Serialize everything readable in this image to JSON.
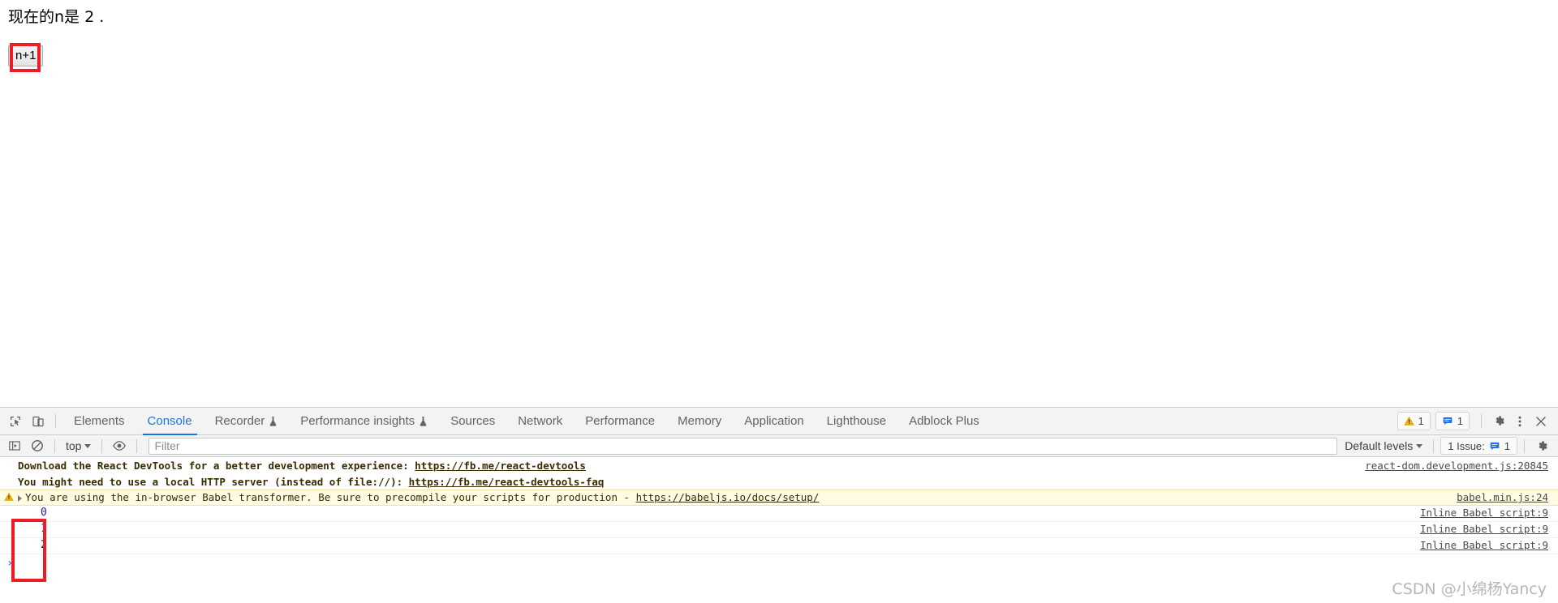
{
  "page": {
    "heading": "现在的n是 2 .",
    "button_label": "n+1"
  },
  "devtools": {
    "tabs": [
      {
        "label": "Elements",
        "active": false,
        "flask": false
      },
      {
        "label": "Console",
        "active": true,
        "flask": false
      },
      {
        "label": "Recorder",
        "active": false,
        "flask": true
      },
      {
        "label": "Performance insights",
        "active": false,
        "flask": true
      },
      {
        "label": "Sources",
        "active": false,
        "flask": false
      },
      {
        "label": "Network",
        "active": false,
        "flask": false
      },
      {
        "label": "Performance",
        "active": false,
        "flask": false
      },
      {
        "label": "Memory",
        "active": false,
        "flask": false
      },
      {
        "label": "Application",
        "active": false,
        "flask": false
      },
      {
        "label": "Lighthouse",
        "active": false,
        "flask": false
      },
      {
        "label": "Adblock Plus",
        "active": false,
        "flask": false
      }
    ],
    "icons": {
      "inspect": "inspect-element-icon",
      "device": "device-toolbar-icon",
      "settings": "gear-icon",
      "more": "kebab-menu-icon",
      "close": "close-icon"
    },
    "warning_badge_count": "1",
    "message_badge_count": "1",
    "accent_color": "#1a73e8",
    "warning_color": "#f0b400",
    "message_color": "#1a73e8"
  },
  "console_toolbar": {
    "sidebar_toggle": "console-sidebar-icon",
    "clear_console": "clear-console-icon",
    "context": "top",
    "eye_icon": "live-expression-eye-icon",
    "filter_placeholder": "Filter",
    "filter_value": "",
    "levels": "Default levels",
    "issues_label": "1 Issue:",
    "issues_count": "1",
    "settings_icon": "gear-icon"
  },
  "console_messages": [
    {
      "type": "info",
      "text": "Download the React DevTools for a better development experience: ",
      "link": "https://fb.me/react-devtools",
      "source": "react-dom.development.js:20845",
      "show_source": true,
      "group": "start"
    },
    {
      "type": "info",
      "text": "You might need to use a local HTTP server (instead of file://): ",
      "link": "https://fb.me/react-devtools-faq",
      "source": "",
      "show_source": false,
      "group": "end"
    },
    {
      "type": "warning",
      "text": "You are using the in-browser Babel transformer. Be sure to precompile your scripts for production - ",
      "link": "https://babeljs.io/docs/setup/",
      "source": "babel.min.js:24",
      "show_source": true,
      "group": "none"
    },
    {
      "type": "log",
      "value": "0",
      "source": "Inline Babel script:9",
      "show_source": true
    },
    {
      "type": "log",
      "value": "1",
      "source": "Inline Babel script:9",
      "show_source": true
    },
    {
      "type": "log",
      "value": "2",
      "source": "Inline Babel script:9",
      "show_source": true
    }
  ],
  "prompt": {
    "caret": "›",
    "value": ""
  },
  "annotations": {
    "color": "#ee1c25"
  },
  "watermark": {
    "text": "CSDN @小绵杨Yancy"
  }
}
